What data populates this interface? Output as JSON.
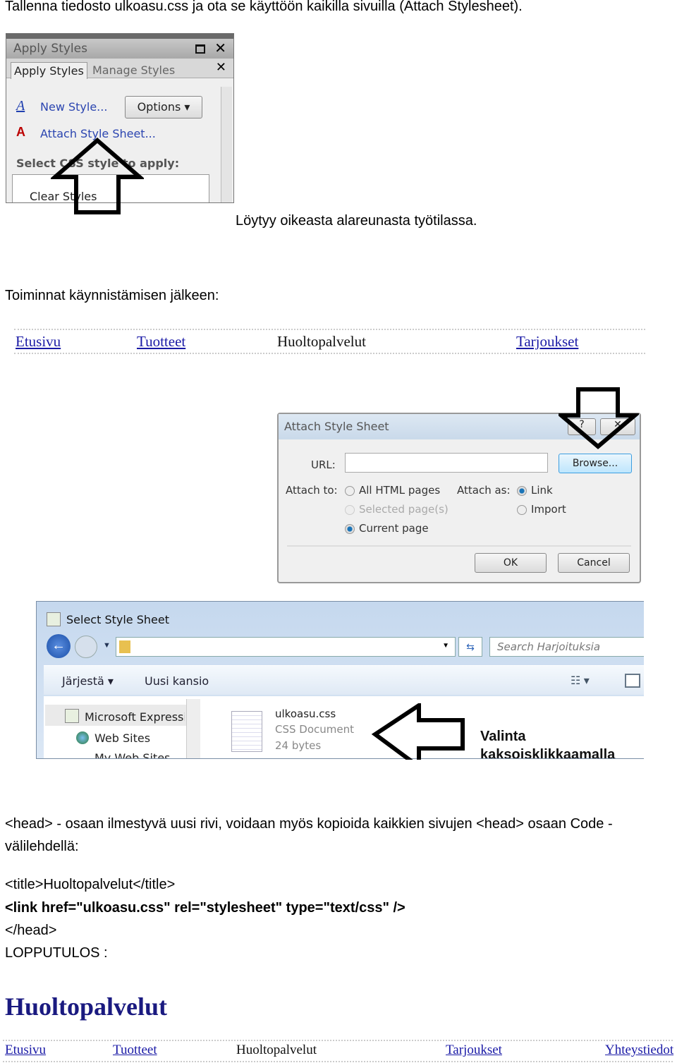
{
  "intro": "Tallenna tiedosto ulkoasu.css ja ota se käyttöön kaikilla sivuilla (Attach Stylesheet).",
  "panel": {
    "title": "Apply Styles",
    "tabs": [
      "Apply Styles",
      "Manage Styles"
    ],
    "new_style": "New Style...",
    "options": "Options",
    "attach": "Attach Style Sheet...",
    "select_label": "Select CSS style to apply:",
    "clear": "Clear Styles"
  },
  "panel_caption": "Löytyy oikeasta alareunasta työtilassa.",
  "after_start": "Toiminnat käynnistämisen jälkeen:",
  "nav1": [
    "Etusivu",
    "Tuotteet",
    "Huoltopalvelut",
    "Tarjoukset"
  ],
  "dialog": {
    "title": "Attach Style Sheet",
    "help": "?",
    "url_label": "URL:",
    "url_value": "",
    "browse": "Browse...",
    "attach_to": "Attach to:",
    "to_options": [
      "All HTML pages",
      "Selected page(s)",
      "Current page"
    ],
    "attach_as": "Attach as:",
    "as_options": [
      "Link",
      "Import"
    ],
    "ok": "OK",
    "cancel": "Cancel"
  },
  "file_dialog": {
    "title": "Select Style Sheet",
    "search_placeholder": "Search Harjoituksia",
    "organize": "Järjestä",
    "new_folder": "Uusi kansio",
    "tree": [
      "Microsoft Expressio",
      "Web Sites",
      "My Web Sites"
    ],
    "file_name": "ulkoasu.css",
    "file_type": "CSS Document",
    "file_size": "24 bytes"
  },
  "annotation": [
    "Valinta",
    "kaksoisklikkaamalla"
  ],
  "head_text": "<head> - osaan ilmestyvä uusi rivi, voidaan myös kopioida kaikkien sivujen <head> osaan Code -",
  "head_text2": "välilehdellä:",
  "code": [
    "<title>Huoltopalvelut</title>",
    "<link href=\"ulkoasu.css\" rel=\"stylesheet\" type=\"text/css\" />",
    "</head>"
  ],
  "result_label": "LOPPUTULOS :",
  "result_title": "Huoltopalvelut",
  "nav2": [
    "Etusivu",
    "Tuotteet",
    "Huoltopalvelut",
    "Tarjoukset",
    "Yhteystiedot"
  ]
}
